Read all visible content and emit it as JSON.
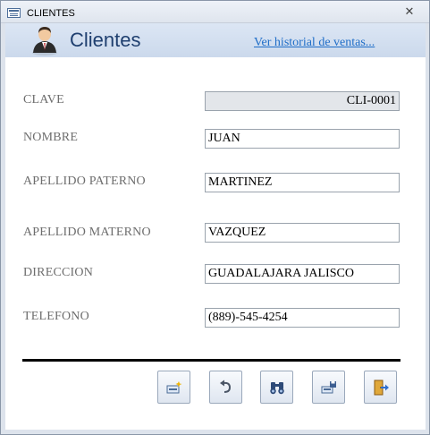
{
  "window": {
    "title": "CLIENTES",
    "close_symbol": "✕"
  },
  "header": {
    "title": "Clientes",
    "history_link": "Ver historial de ventas...",
    "avatar_icon": "business-person-icon"
  },
  "fields": {
    "clave": {
      "label": "CLAVE",
      "value": "CLI-0001"
    },
    "nombre": {
      "label": "NOMBRE",
      "value": "JUAN"
    },
    "apellido_paterno": {
      "label": "APELLIDO PATERNO",
      "value": "MARTINEZ"
    },
    "apellido_materno": {
      "label": "APELLIDO MATERNO",
      "value": "VAZQUEZ"
    },
    "direccion": {
      "label": "DIRECCION",
      "value": "GUADALAJARA JALISCO"
    },
    "telefono": {
      "label": "TELEFONO",
      "value": "(889)-545-4254"
    }
  },
  "toolbar": {
    "buttons": [
      {
        "name": "new-record",
        "icon": "new-record-icon"
      },
      {
        "name": "undo",
        "icon": "undo-icon"
      },
      {
        "name": "search",
        "icon": "binoculars-icon"
      },
      {
        "name": "save-record",
        "icon": "save-record-icon"
      },
      {
        "name": "exit",
        "icon": "exit-door-icon"
      }
    ]
  },
  "colors": {
    "header_title": "#1f3f6f",
    "link": "#1e6dc8",
    "label": "#6d6d6d"
  }
}
